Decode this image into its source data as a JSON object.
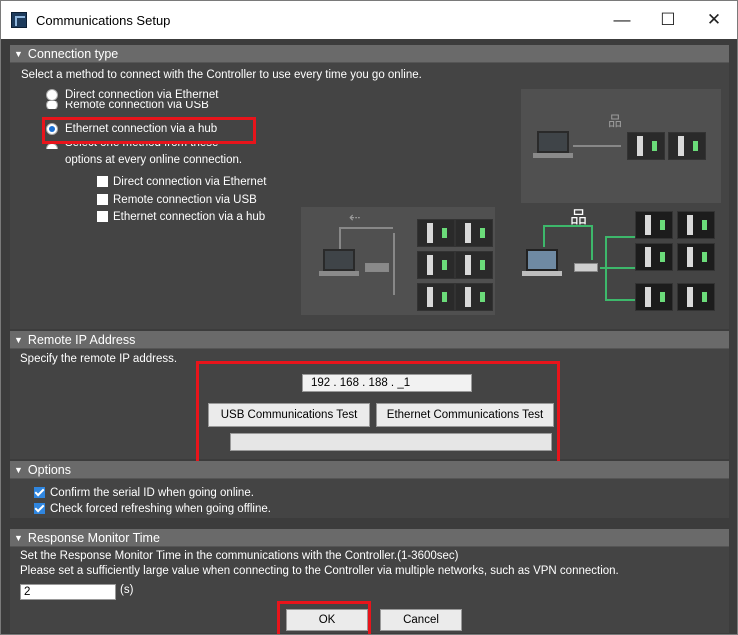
{
  "window": {
    "title": "Communications Setup",
    "minimize": "—",
    "maximize": "☐",
    "close": "✕"
  },
  "connection": {
    "header": "Connection type",
    "prompt": "Select a method to connect with the Controller to use every time you go online.",
    "options": [
      "Direct connection via Ethernet",
      "Remote connection via USB",
      "Ethernet connection via a hub",
      "Select one method from these",
      "options at every online connection."
    ],
    "selected": "Ethernet connection via a hub",
    "sub_options": [
      "Direct connection via Ethernet",
      "Remote connection via USB",
      "Ethernet connection via a hub"
    ],
    "usb_symbol": "⇠",
    "network_symbol": "品"
  },
  "remote_ip": {
    "header": "Remote IP Address",
    "prompt": "Specify the remote IP address.",
    "ip_value": "192 . 168 . 188 . _1",
    "usb_test": "USB Communications Test",
    "eth_test": "Ethernet Communications Test"
  },
  "options": {
    "header": "Options",
    "items": [
      "Confirm the serial ID when going online.",
      "Check forced refreshing when going offline."
    ]
  },
  "response": {
    "header": "Response Monitor Time",
    "line1": "Set the Response Monitor Time in the communications with the Controller.(1-3600sec)",
    "line2": "Please set a sufficiently large value when connecting to the Controller via multiple networks, such as VPN connection.",
    "value": "2",
    "unit": "(s)"
  },
  "buttons": {
    "ok": "OK",
    "cancel": "Cancel"
  },
  "colors": {
    "highlight": "#e8141b",
    "panel": "#444444",
    "header": "#6a6a6a",
    "link": "#3db86b"
  }
}
